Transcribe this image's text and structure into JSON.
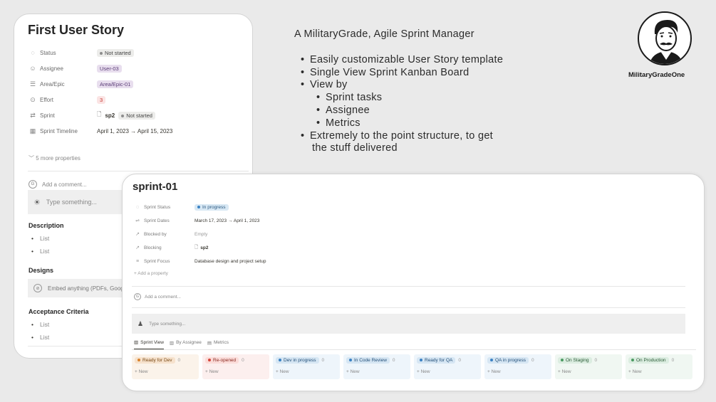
{
  "story": {
    "title": "First User Story",
    "properties": [
      {
        "label": "Status",
        "value": "Not started",
        "icon": "status-icon"
      },
      {
        "label": "Assignee",
        "value": "User-03",
        "icon": "person-icon"
      },
      {
        "label": "Area/Epic",
        "value": "Area/Epic-01",
        "icon": "list-icon"
      },
      {
        "label": "Effort",
        "value": "3",
        "icon": "effort-icon"
      },
      {
        "label": "Sprint",
        "value": "sp2",
        "value2": "Not started",
        "icon": "relation-icon"
      },
      {
        "label": "Sprint Timeline",
        "value": "April 1, 2023 → April 15, 2023",
        "icon": "calendar-icon"
      }
    ],
    "more_properties": "5 more properties",
    "comment_placeholder": "Add a comment...",
    "type_placeholder": "Type something...",
    "description_title": "Description",
    "description_items": [
      "List",
      "List"
    ],
    "designs_title": "Designs",
    "embed_text": "Embed anything (PDFs, Goog",
    "acceptance_title": "Acceptance Criteria",
    "acceptance_items": [
      "List",
      "List"
    ]
  },
  "info": {
    "heading": "A MilitaryGrade, Agile Sprint Manager",
    "bullets": [
      "Easily customizable User Story template",
      "Single View Sprint Kanban Board",
      "View by"
    ],
    "sub_bullets": [
      "Sprint tasks",
      "Assignee",
      "Metrics"
    ],
    "last_bullet_line1": "Extremely to the point structure, to get",
    "last_bullet_line2": "the stuff delivered"
  },
  "brand": {
    "name": "MilitaryGradeOne"
  },
  "sprint": {
    "title": "sprint-01",
    "properties": [
      {
        "label": "Sprint Status",
        "value": "In progress",
        "icon": "status-icon"
      },
      {
        "label": "Sprint Dates",
        "value": "March 17, 2023 → April 1, 2023",
        "icon": "dates-icon"
      },
      {
        "label": "Blocked by",
        "value": "Empty",
        "icon": "arrow-icon"
      },
      {
        "label": "Blocking",
        "value": "sp2",
        "icon": "arrow-icon"
      },
      {
        "label": "Sprint Focus",
        "value": "Database design and project setup",
        "icon": "text-icon"
      }
    ],
    "add_property": "Add a property",
    "comment_placeholder": "Add a comment...",
    "type_placeholder": "Type something...",
    "tabs": [
      "Sprint View",
      "By Assignee",
      "Metrics"
    ],
    "columns": [
      {
        "name": "Ready for Dev",
        "count": "0",
        "new": "+ New",
        "bg": "#fbf3ea",
        "chip": "#f6e2cd",
        "dot": "#d9822b",
        "text": "#7a4a16"
      },
      {
        "name": "Re-opened",
        "count": "0",
        "new": "+ New",
        "bg": "#fcefee",
        "chip": "#fbdcd9",
        "dot": "#d4453b",
        "text": "#8a2c24"
      },
      {
        "name": "Dev in progress",
        "count": "0",
        "new": "+ New",
        "bg": "#eef5fb",
        "chip": "#d6e6f3",
        "dot": "#3b82c4",
        "text": "#24507a"
      },
      {
        "name": "In Code Review",
        "count": "0",
        "new": "+ New",
        "bg": "#eef5fb",
        "chip": "#d6e6f3",
        "dot": "#3b82c4",
        "text": "#24507a"
      },
      {
        "name": "Ready for QA",
        "count": "0",
        "new": "+ New",
        "bg": "#eef5fb",
        "chip": "#d6e6f3",
        "dot": "#3b82c4",
        "text": "#24507a"
      },
      {
        "name": "QA in progress",
        "count": "0",
        "new": "+ New",
        "bg": "#eef5fb",
        "chip": "#d6e6f3",
        "dot": "#3b82c4",
        "text": "#24507a"
      },
      {
        "name": "On Staging",
        "count": "0",
        "new": "+ New",
        "bg": "#f0f7f2",
        "chip": "#dcede1",
        "dot": "#4b9b62",
        "text": "#2b5c37"
      },
      {
        "name": "On Production",
        "count": "0",
        "new": "+ New",
        "bg": "#f0f7f2",
        "chip": "#dcede1",
        "dot": "#4b9b62",
        "text": "#2b5c37"
      }
    ]
  }
}
